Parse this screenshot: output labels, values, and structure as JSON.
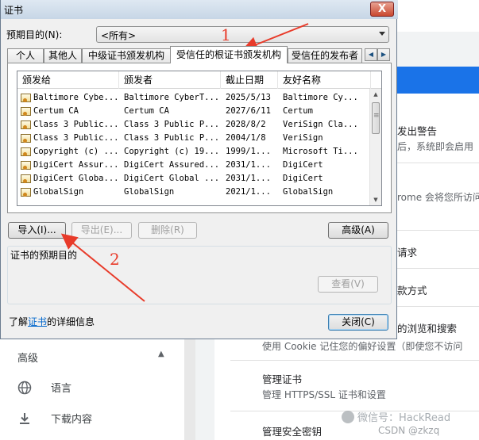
{
  "dialog": {
    "title": "证书",
    "close_label": "X",
    "purpose_label": "预期目的(N):",
    "purpose_value": "<所有>",
    "tabs": [
      "个人",
      "其他人",
      "中级证书颁发机构",
      "受信任的根证书颁发机构",
      "受信任的发布者"
    ],
    "active_tab": "受信任的根证书颁发机构",
    "columns": [
      "颁发给",
      "颁发者",
      "截止日期",
      "友好名称"
    ],
    "rows": [
      {
        "issued_to": "Baltimore Cybe...",
        "issued_by": "Baltimore CyberT...",
        "expires": "2025/5/13",
        "friendly": "Baltimore Cy..."
      },
      {
        "issued_to": "Certum CA",
        "issued_by": "Certum CA",
        "expires": "2027/6/11",
        "friendly": "Certum"
      },
      {
        "issued_to": "Class 3 Public...",
        "issued_by": "Class 3 Public P...",
        "expires": "2028/8/2",
        "friendly": "VeriSign Cla..."
      },
      {
        "issued_to": "Class 3 Public...",
        "issued_by": "Class 3 Public P...",
        "expires": "2004/1/8",
        "friendly": "VeriSign"
      },
      {
        "issued_to": "Copyright (c) ...",
        "issued_by": "Copyright (c) 19...",
        "expires": "1999/1...",
        "friendly": "Microsoft Ti..."
      },
      {
        "issued_to": "DigiCert Assur...",
        "issued_by": "DigiCert Assured...",
        "expires": "2031/1...",
        "friendly": "DigiCert"
      },
      {
        "issued_to": "DigiCert Globa...",
        "issued_by": "DigiCert Global ...",
        "expires": "2031/1...",
        "friendly": "DigiCert"
      },
      {
        "issued_to": "GlobalSign",
        "issued_by": "GlobalSign",
        "expires": "2021/1...",
        "friendly": "GlobalSign"
      }
    ],
    "buttons": {
      "import": "导入(I)...",
      "export": "导出(E)...",
      "remove": "删除(R)",
      "advanced": "高级(A)",
      "view": "查看(V)",
      "close": "关闭(C)"
    },
    "purposes_group_label": "证书的预期目的",
    "info_prefix": "了解",
    "info_link": "证书",
    "info_suffix": "的详细信息"
  },
  "annotations": {
    "step1": "1",
    "step2": "2",
    "color": "#e83b2a"
  },
  "background": {
    "right_items": [
      {
        "title": "发出警告",
        "sub": "后，系统即会启用"
      },
      {
        "title": "",
        "sub": "rome 会将您所访问"
      },
      {
        "title": "请求",
        "sub": ""
      },
      {
        "title": "款方式",
        "sub": ""
      },
      {
        "title": "的浏览和搜索",
        "sub": "使用 Cookie 记住您的偏好设置（即使您不访问"
      },
      {
        "title": "管理证书",
        "sub": "管理 HTTPS/SSL 证书和设置"
      },
      {
        "title": "管理安全密钥",
        "sub": ""
      }
    ],
    "left_nav": {
      "section": "高级",
      "items": [
        {
          "icon": "globe-icon",
          "label": "语言"
        },
        {
          "icon": "download-icon",
          "label": "下载内容"
        }
      ]
    },
    "watermark": "微信号：HackRead",
    "watermark2": "CSDN @zkzq"
  }
}
